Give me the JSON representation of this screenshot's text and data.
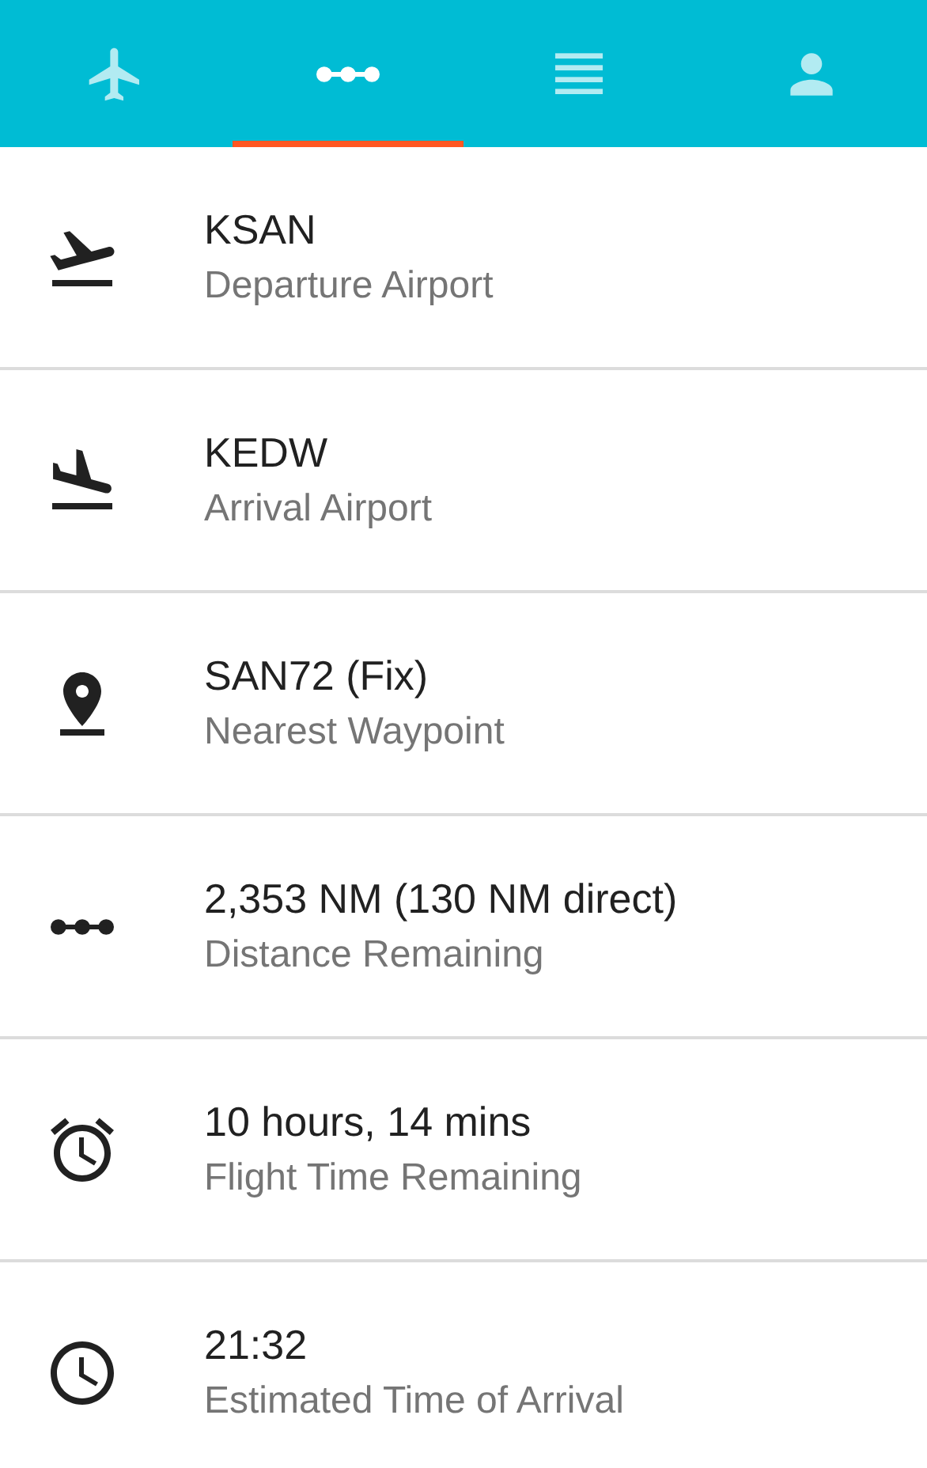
{
  "tabs": [
    {
      "kind": "plane",
      "selected": false
    },
    {
      "kind": "route",
      "selected": true
    },
    {
      "kind": "list",
      "selected": false
    },
    {
      "kind": "person",
      "selected": false
    }
  ],
  "rows": [
    {
      "kind": "takeoff",
      "title": "KSAN",
      "subtitle": "Departure Airport"
    },
    {
      "kind": "landing",
      "title": "KEDW",
      "subtitle": "Arrival Airport"
    },
    {
      "kind": "pin",
      "title": "SAN72 (Fix)",
      "subtitle": "Nearest Waypoint"
    },
    {
      "kind": "route",
      "title": "2,353 NM (130 NM direct)",
      "subtitle": "Distance Remaining"
    },
    {
      "kind": "alarm",
      "title": "10 hours, 14 mins",
      "subtitle": "Flight Time Remaining"
    },
    {
      "kind": "clock",
      "title": "21:32",
      "subtitle": "Estimated Time of Arrival"
    }
  ]
}
